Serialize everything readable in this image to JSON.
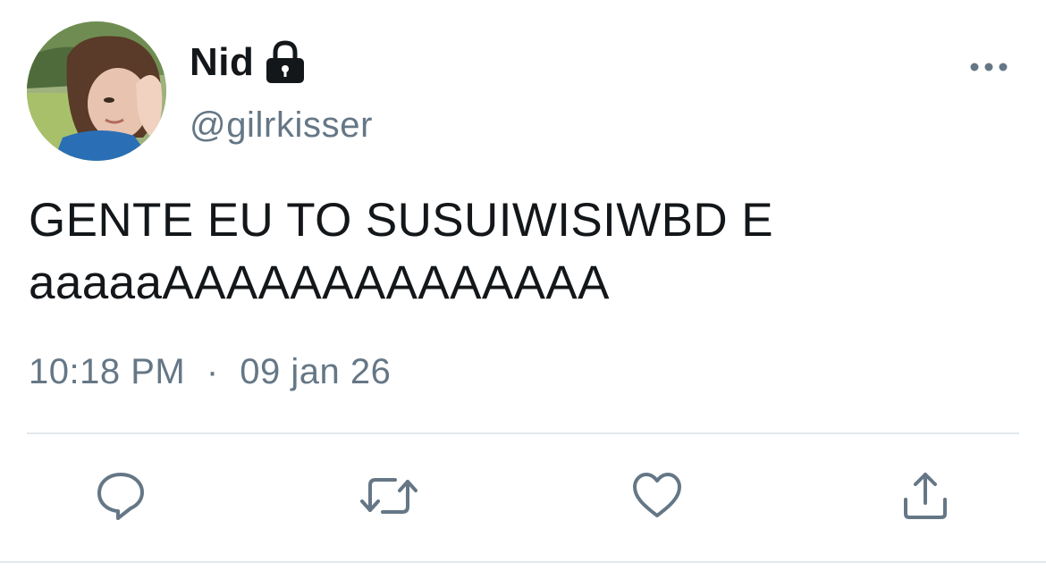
{
  "user": {
    "display_name": "Nid",
    "handle": "@gilrkisser",
    "protected_icon": "lock-icon",
    "avatar_icon": "profile-photo"
  },
  "tweet": {
    "text": "GENTE EU TO SUSUIWISIWBD E\naaaaaAAAAAAAAAAAAAA",
    "time": "10:18 PM",
    "separator": "·",
    "date": "09 jan 26"
  },
  "actions": [
    {
      "name": "reply",
      "icon": "comment-bubble-icon"
    },
    {
      "name": "retweet",
      "icon": "retweet-arrows-icon"
    },
    {
      "name": "like",
      "icon": "heart-icon"
    },
    {
      "name": "share",
      "icon": "share-upload-icon"
    }
  ],
  "colors": {
    "primary_text": "#14171a",
    "secondary_text": "#657786",
    "divider": "#e1e8ed",
    "icon": "#657786"
  }
}
